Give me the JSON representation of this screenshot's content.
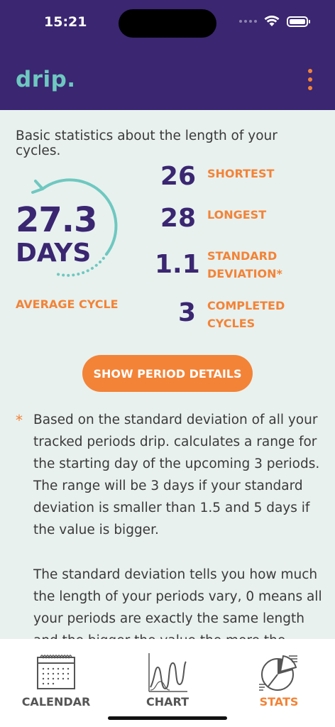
{
  "status_bar": {
    "time": "15:21"
  },
  "app": {
    "logo": "drip."
  },
  "stats": {
    "intro": "Basic statistics about the length of your cycles.",
    "average": {
      "number": "27.3",
      "unit": "DAYS",
      "label": "AVERAGE CYCLE"
    },
    "items": [
      {
        "value": "26",
        "label": "SHORTEST"
      },
      {
        "value": "28",
        "label": "LONGEST"
      },
      {
        "value": "1.1",
        "label": "STANDARD DEVIATION*"
      },
      {
        "value": "3",
        "label": "COMPLETED CYCLES"
      }
    ],
    "button_label": "SHOW PERIOD DETAILS",
    "note_marker": "*",
    "note_paragraph_1": "Based on the standard deviation of all your tracked periods drip. calculates a range for the starting day of the upcoming 3 periods. The range will be 3 days if your standard deviation is smaller than 1.5 and 5 days if the value is bigger.",
    "note_paragraph_2": "The standard deviation tells you how much the length of your periods vary, 0 means all your periods are exactly the same length and the bigger the value the more the period"
  },
  "nav": {
    "items": [
      {
        "label": "CALENDAR",
        "icon": "calendar-icon"
      },
      {
        "label": "CHART",
        "icon": "chart-icon"
      },
      {
        "label": "STATS",
        "icon": "stats-icon"
      }
    ],
    "active": "STATS"
  },
  "colors": {
    "header_bg": "#3a2671",
    "accent_orange": "#f38337",
    "teal": "#6ec8c0",
    "content_bg": "#e8f1ee",
    "number_purple": "#3a2671"
  }
}
